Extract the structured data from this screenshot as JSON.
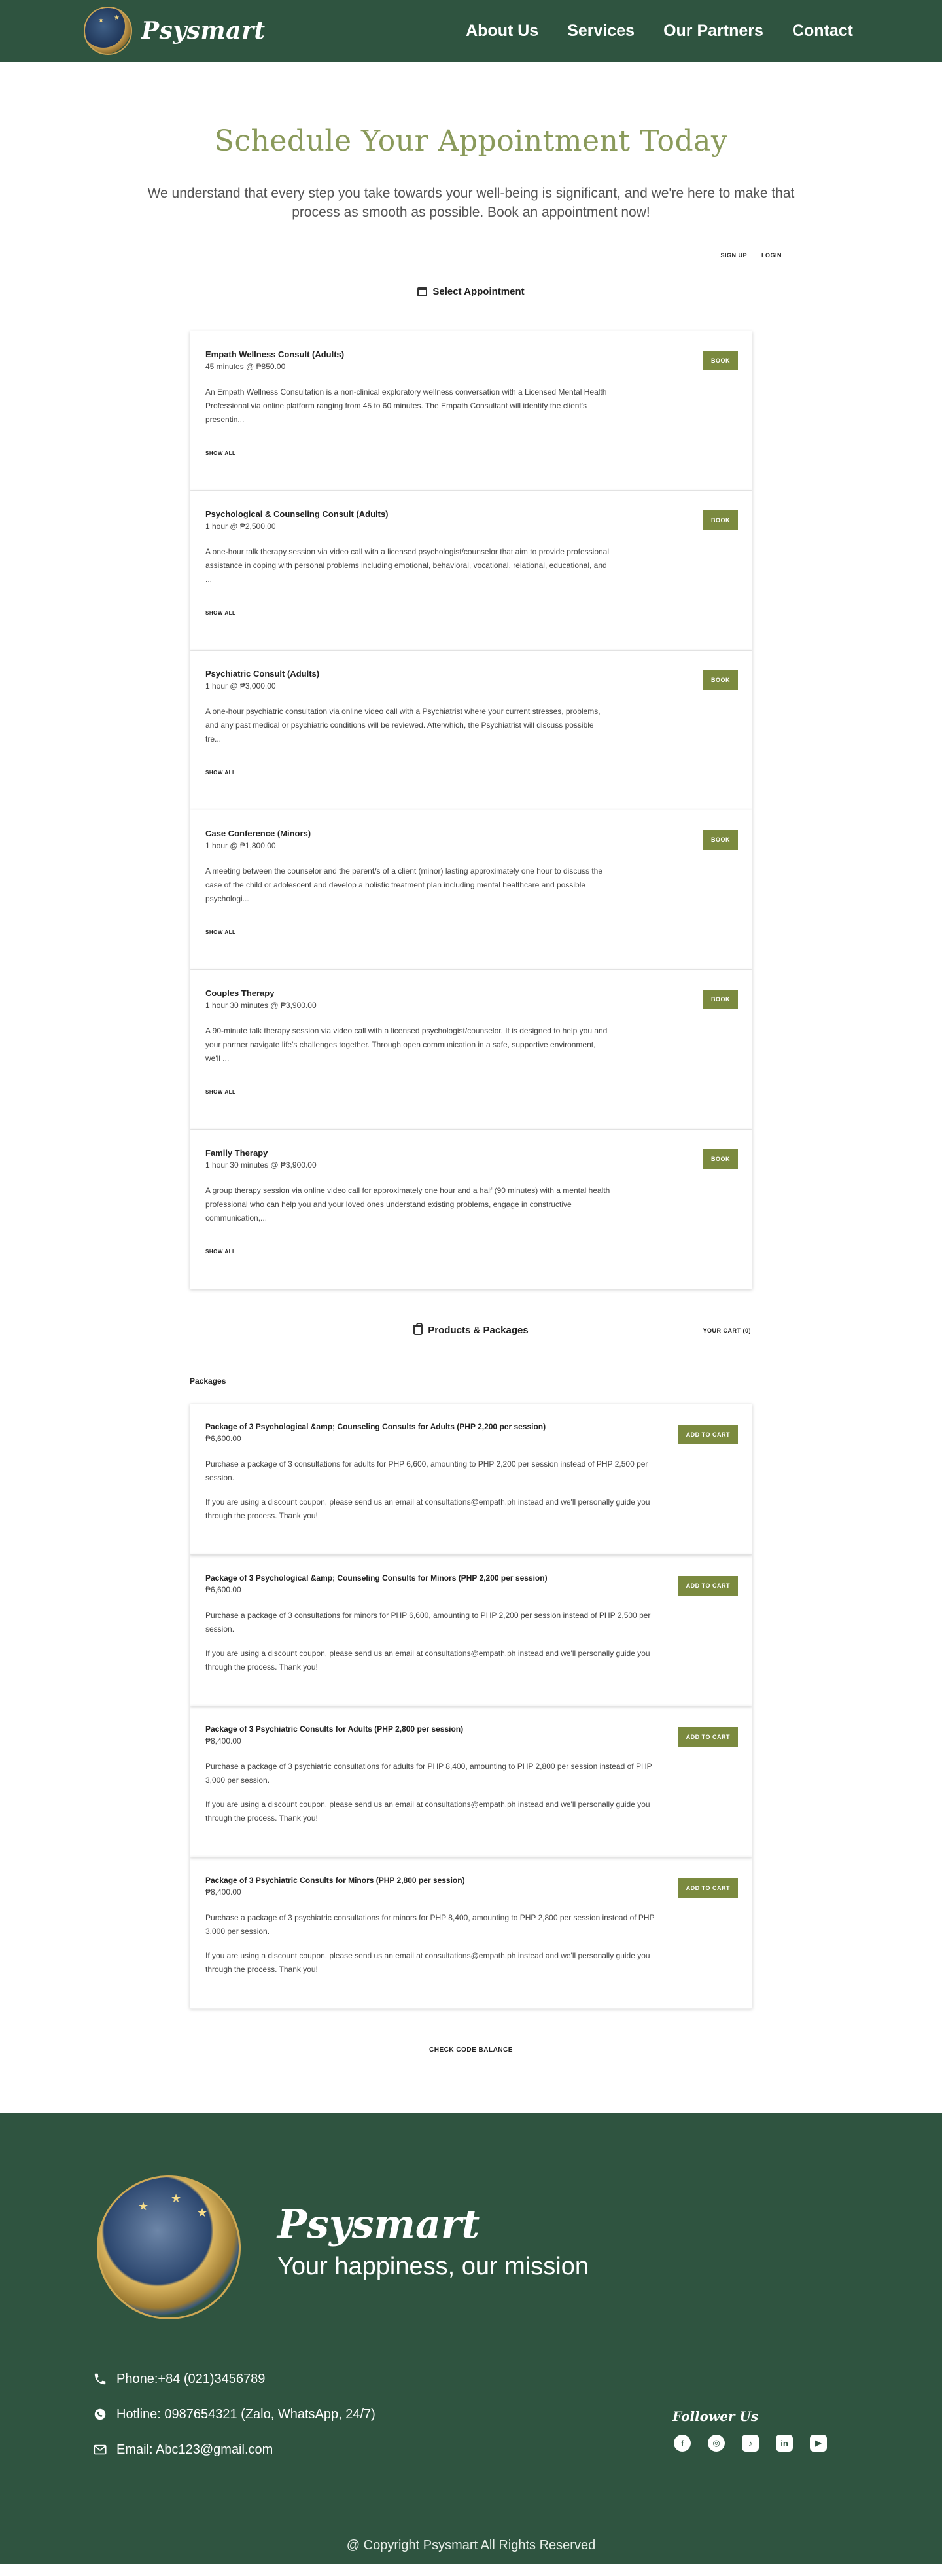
{
  "header": {
    "brand": "Psysmart",
    "nav": [
      "About Us",
      "Services",
      "Our Partners",
      "Contact"
    ]
  },
  "hero": {
    "title": "Schedule Your Appointment Today",
    "subtitle": "We understand that every step you take towards your well-being is significant, and we're here to make that process as smooth as possible. Book an appointment now!"
  },
  "booking": {
    "auth": [
      "SIGN UP",
      "LOGIN"
    ],
    "select_heading": "Select Appointment",
    "show_all": "SHOW ALL",
    "book_label": "BOOK",
    "services": [
      {
        "name": "Empath Wellness Consult (Adults)",
        "meta": "45 minutes @ ₱850.00",
        "desc": "An Empath Wellness Consultation is a non-clinical exploratory wellness conversation with a Licensed Mental Health Professional via online platform ranging from 45 to 60 minutes. The Empath Consultant will identify the client's presentin..."
      },
      {
        "name": "Psychological & Counseling Consult (Adults)",
        "meta": "1 hour @ ₱2,500.00",
        "desc": "A one-hour talk therapy session via video call with a licensed psychologist/counselor that aim to provide professional assistance in coping with personal problems including emotional, behavioral, vocational, relational, educational, and ..."
      },
      {
        "name": "Psychiatric Consult (Adults)",
        "meta": "1 hour @ ₱3,000.00",
        "desc": "A one-hour psychiatric consultation via online video call with a Psychiatrist where your current stresses, problems, and any past medical or psychiatric conditions will be reviewed. Afterwhich, the Psychiatrist will discuss possible tre..."
      },
      {
        "name": "Case Conference (Minors)",
        "meta": "1 hour @ ₱1,800.00",
        "desc": "A meeting between the counselor and the parent/s of a client (minor) lasting approximately one hour to discuss the case of the child or adolescent and develop a holistic treatment plan including mental healthcare and possible psychologi..."
      },
      {
        "name": "Couples Therapy",
        "meta": "1 hour 30 minutes @ ₱3,900.00",
        "desc": "A 90-minute talk therapy session via video call with a licensed psychologist/counselor. It is designed to help you and your partner navigate life's challenges together. Through open communication in a safe, supportive environment, we'll ..."
      },
      {
        "name": "Family Therapy",
        "meta": "1 hour 30 minutes @ ₱3,900.00",
        "desc": "A group therapy session via online video call for approximately one hour and a half (90 minutes) with a mental health professional who can help you and your loved ones understand existing problems, engage in constructive communication,..."
      }
    ]
  },
  "products": {
    "heading": "Products & Packages",
    "cart": "YOUR CART (0)",
    "packages_label": "Packages",
    "add_label": "ADD TO CART",
    "items": [
      {
        "name": "Package of 3 Psychological &amp; Counseling Consults for Adults (PHP 2,200 per session)",
        "price": "₱6,600.00",
        "desc": "Purchase a package of 3 consultations for adults for PHP 6,600, amounting to PHP 2,200 per session instead of PHP 2,500 per session.",
        "note": "If you are using a discount coupon, please send us an email at consultations@empath.ph instead and we'll personally guide you through the process. Thank you!"
      },
      {
        "name": "Package of 3 Psychological &amp; Counseling Consults for Minors (PHP 2,200 per session)",
        "price": "₱6,600.00",
        "desc": "Purchase a package of 3 consultations for minors for PHP 6,600, amounting to PHP 2,200 per session instead of PHP 2,500 per session.",
        "note": "If you are using a discount coupon, please send us an email at consultations@empath.ph instead and we'll personally guide you through the process. Thank you!"
      },
      {
        "name": "Package of 3 Psychiatric Consults for Adults (PHP 2,800 per session)",
        "price": "₱8,400.00",
        "desc": "Purchase a package of 3 psychiatric consultations for adults for PHP 8,400, amounting to PHP 2,800 per session instead of PHP 3,000 per session.",
        "note": "If you are using a discount coupon, please send us an email at consultations@empath.ph instead and we'll personally guide you through the process. Thank you!"
      },
      {
        "name": "Package of 3 Psychiatric Consults for Minors (PHP 2,800 per session)",
        "price": "₱8,400.00",
        "desc": "Purchase a package of 3 psychiatric consultations for minors for PHP 8,400, amounting to PHP 2,800 per session instead of PHP 3,000 per session.",
        "note": "If you are using a discount coupon, please send us an email at consultations@empath.ph instead and we'll personally guide you through the process. Thank you!"
      }
    ],
    "code_balance": "CHECK CODE BALANCE"
  },
  "footer": {
    "brand": "Psysmart",
    "slogan": "Your happiness, our mission",
    "phone": "Phone:+84 (021)3456789",
    "hotline": "Hotline: 0987654321 (Zalo, WhatsApp, 24/7)",
    "email": "Email: Abc123@gmail.com",
    "follow": "Follower Us",
    "social_icons": [
      "facebook-icon",
      "instagram-icon",
      "tiktok-icon",
      "linkedin-icon",
      "youtube-icon"
    ],
    "copyright": "@ Copyright Psysmart All Rights Reserved"
  },
  "colors": {
    "primary": "#2f5440",
    "accent": "#7b8a3f",
    "title": "#8a9a5b"
  }
}
